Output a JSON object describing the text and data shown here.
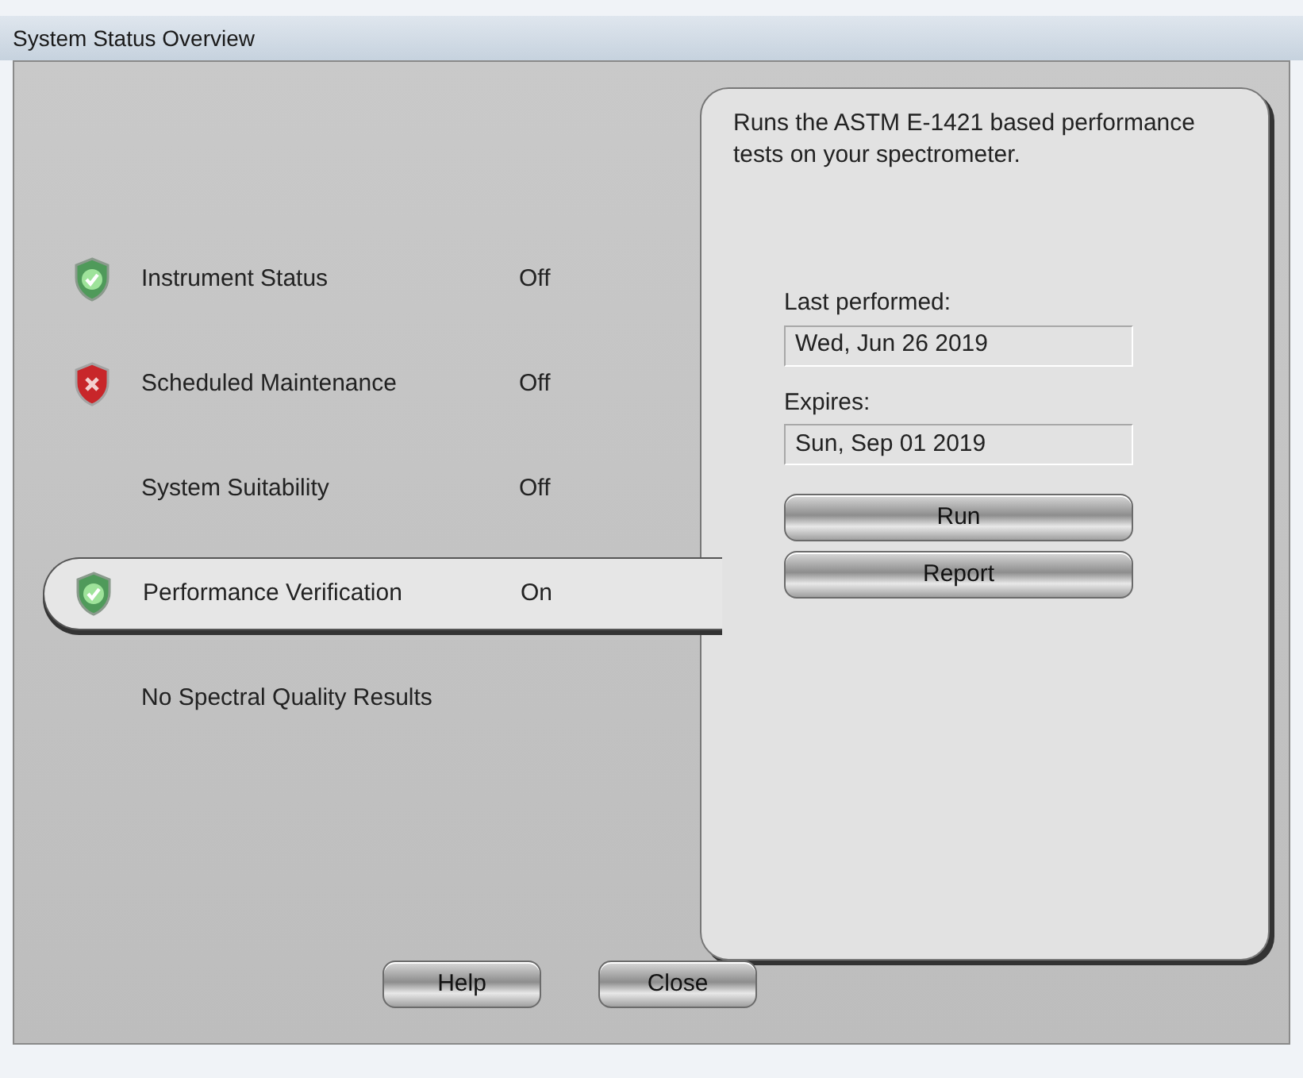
{
  "window": {
    "title": "System Status Overview"
  },
  "items": [
    {
      "kind": "status",
      "label": "Instrument Status",
      "status_icon": true,
      "passed": true,
      "value": "Off",
      "selected": false
    },
    {
      "kind": "status",
      "label": "Scheduled Maintenance",
      "status_icon": true,
      "passed": false,
      "value": "Off",
      "selected": false
    },
    {
      "kind": "status",
      "label": "System Suitability",
      "status_icon": false,
      "value": "Off",
      "selected": false
    },
    {
      "kind": "status",
      "label": "Performance Verification",
      "status_icon": true,
      "passed": true,
      "value": "On",
      "selected": true
    },
    {
      "kind": "message",
      "label": "No Spectral Quality Results"
    }
  ],
  "detail": {
    "description": "Runs the ASTM E-1421 based performance tests on your spectrometer.",
    "fields": [
      {
        "label": "Last performed:",
        "value": "Wed, Jun 26 2019"
      },
      {
        "label": "Expires:",
        "value": "Sun, Sep 01 2019"
      }
    ],
    "buttons": [
      "Run",
      "Report"
    ]
  },
  "buttons": [
    "Help",
    "Close"
  ]
}
